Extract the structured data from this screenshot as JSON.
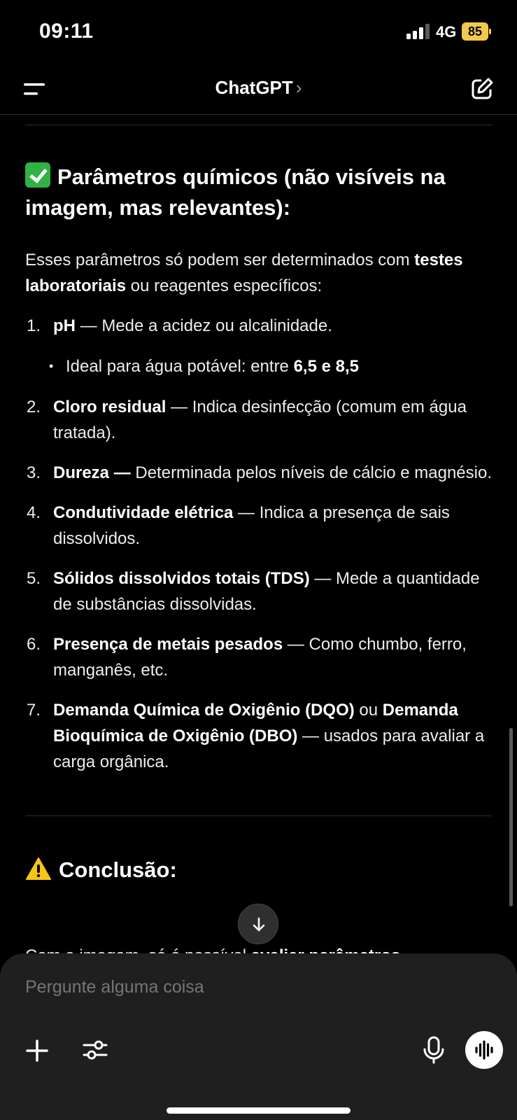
{
  "status_bar": {
    "time": "09:11",
    "network": "4G",
    "battery": "85",
    "battery_color": "#f2c94c"
  },
  "header": {
    "title": "ChatGPT",
    "chevron": "›"
  },
  "section1": {
    "icon": "check-mark-button-emoji",
    "title": "Parâmetros químicos (não visíveis na imagem, mas relevantes):",
    "intro_pre": "Esses parâmetros só podem ser determinados com ",
    "intro_bold": "testes laboratoriais",
    "intro_post": " ou reagentes específicos:",
    "items": [
      {
        "num": "1.",
        "bold": "pH",
        "text": " — Mede a acidez ou alcalinidade.",
        "sub": {
          "pre": "Ideal para água potável: entre ",
          "bold": "6,5 e 8,5"
        }
      },
      {
        "num": "2.",
        "bold": "Cloro residual",
        "text": " — Indica desinfecção (comum em água tratada)."
      },
      {
        "num": "3.",
        "bold": "Dureza —",
        "text": " Determinada pelos níveis de cálcio e magnésio."
      },
      {
        "num": "4.",
        "bold": "Condutividade elétrica",
        "text": " — Indica a presença de sais dissolvidos."
      },
      {
        "num": "5.",
        "bold": "Sólidos dissolvidos totais (TDS)",
        "text": " — Mede a quantidade de substâncias dissolvidas."
      },
      {
        "num": "6.",
        "bold": "Presença de metais pesados",
        "text": " — Como chumbo, ferro, manganês, etc."
      },
      {
        "num": "7.",
        "bold": "Demanda Química de Oxigênio (DQO)",
        "mid": " ou ",
        "bold2": "Demanda Bioquímica de Oxigênio (DBO)",
        "text": " — usados para avaliar a carga orgânica."
      }
    ]
  },
  "section2": {
    "icon": "warning-emoji",
    "title": "Conclusão:",
    "cut_pre": "Com a imagem, só é possível ",
    "cut_bold": "avaliar parâmetros"
  },
  "composer": {
    "placeholder": "Pergunte alguma coisa"
  },
  "colors": {
    "background": "#000000",
    "composer": "#1f1f1f",
    "accent_check": "#2fb344",
    "warning": "#f5c518"
  }
}
